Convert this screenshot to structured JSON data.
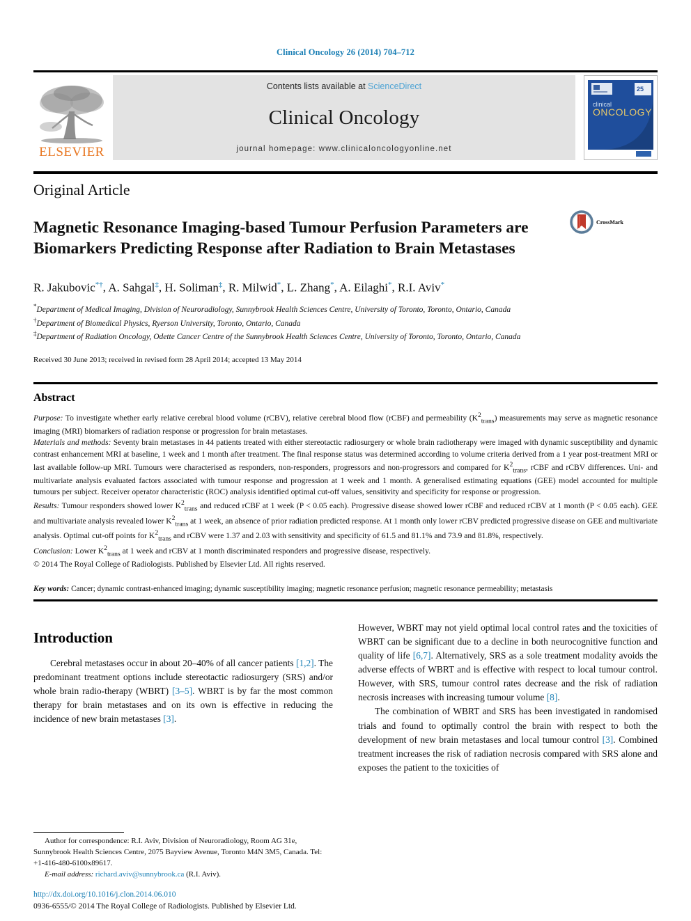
{
  "running_head": "Clinical Oncology 26 (2014) 704–712",
  "masthead": {
    "contents_prefix": "Contents lists available at ",
    "sciencedirect": "ScienceDirect",
    "journal_title": "Clinical Oncology",
    "homepage": "journal homepage: www.clinicaloncologyonline.net",
    "publisher_logo_text": "ELSEVIER",
    "cover_line1": "clinical",
    "cover_line2": "ONCOLOGY",
    "cover_badge": "25"
  },
  "article": {
    "type": "Original Article",
    "title": "Magnetic Resonance Imaging-based Tumour Perfusion Parameters are Biomarkers Predicting Response after Radiation to Brain Metastases",
    "crossmark_label": "CrossMark",
    "authors_html": "R. Jakubovic<sup class=\"sup-mark\">*†</sup>, A. Sahgal<sup class=\"sup-mark\">‡</sup>, H. Soliman<sup class=\"sup-mark\">‡</sup>, R. Milwid<sup class=\"sup-mark\">*</sup>, L. Zhang<sup class=\"sup-mark\">*</sup>, A. Eilaghi<sup class=\"sup-mark\">*</sup>, R.I. Aviv<sup class=\"sup-mark\">*</sup>",
    "affiliations": [
      {
        "marker": "*",
        "text": "Department of Medical Imaging, Division of Neuroradiology, Sunnybrook Health Sciences Centre, University of Toronto, Toronto, Ontario, Canada"
      },
      {
        "marker": "†",
        "text": "Department of Biomedical Physics, Ryerson University, Toronto, Ontario, Canada"
      },
      {
        "marker": "‡",
        "text": "Department of Radiation Oncology, Odette Cancer Centre of the Sunnybrook Health Sciences Centre, University of Toronto, Toronto, Ontario, Canada"
      }
    ],
    "dates": "Received 30 June 2013; received in revised form 28 April 2014; accepted 13 May 2014"
  },
  "abstract": {
    "heading": "Abstract",
    "purpose_label": "Purpose:",
    "purpose_text": " To investigate whether early relative cerebral blood volume (rCBV), relative cerebral blood flow (rCBF) and permeability (K<sup>2</sup><sub>trans</sub>) measurements may serve as magnetic resonance imaging (MRI) biomarkers of radiation response or progression for brain metastases.",
    "methods_label": "Materials and methods:",
    "methods_text": " Seventy brain metastases in 44 patients treated with either stereotactic radiosurgery or whole brain radiotherapy were imaged with dynamic susceptibility and dynamic contrast enhancement MRI at baseline, 1 week and 1 month after treatment. The final response status was determined according to volume criteria derived from a 1 year post-treatment MRI or last available follow-up MRI. Tumours were characterised as responders, non-responders, progressors and non-progressors and compared for K<sup>2</sup><sub>trans</sub>, rCBF and rCBV differences. Uni- and multivariate analysis evaluated factors associated with tumour response and progression at 1 week and 1 month. A generalised estimating equations (GEE) model accounted for multiple tumours per subject. Receiver operator characteristic (ROC) analysis identified optimal cut-off values, sensitivity and specificity for response or progression.",
    "results_label": "Results:",
    "results_text": " Tumour responders showed lower K<sup>2</sup><sub>trans</sub> and reduced rCBF at 1 week (P < 0.05 each). Progressive disease showed lower rCBF and reduced rCBV at 1 month (P < 0.05 each). GEE and multivariate analysis revealed lower K<sup>2</sup><sub>trans</sub> at 1 week, an absence of prior radiation predicted response. At 1 month only lower rCBV predicted progressive disease on GEE and multivariate analysis. Optimal cut-off points for K<sup>2</sup><sub>trans</sub> and rCBV were 1.37 and 2.03 with sensitivity and specificity of 61.5 and 81.1% and 73.9 and 81.8%, respectively.",
    "conclusion_label": "Conclusion:",
    "conclusion_text": " Lower K<sup>2</sup><sub>trans</sub> at 1 week and rCBV at 1 month discriminated responders and progressive disease, respectively.",
    "copyright": "© 2014 The Royal College of Radiologists. Published by Elsevier Ltd. All rights reserved.",
    "keywords_label": "Key words:",
    "keywords_text": " Cancer; dynamic contrast-enhanced imaging; dynamic susceptibility imaging; magnetic resonance perfusion; magnetic resonance permeability; metastasis"
  },
  "body": {
    "intro_heading": "Introduction",
    "col1_para1_html": "Cerebral metastases occur in about 20–40% of all cancer patients <span class=\"ref\">[1,2]</span>. The predominant treatment options include stereotactic radiosurgery (SRS) and/or whole brain radio-therapy (WBRT) <span class=\"ref\">[3–5]</span>. WBRT is by far the most common therapy for brain metastases and on its own is effective in reducing the incidence of new brain metastases <span class=\"ref\">[3]</span>.",
    "col2_para1_html": "However, WBRT may not yield optimal local control rates and the toxicities of WBRT can be significant due to a decline in both neurocognitive function and quality of life <span class=\"ref\">[6,7]</span>. Alternatively, SRS as a sole treatment modality avoids the adverse effects of WBRT and is effective with respect to local tumour control. However, with SRS, tumour control rates decrease and the risk of radiation necrosis increases with increasing tumour volume <span class=\"ref\">[8]</span>.",
    "col2_para2_html": "The combination of WBRT and SRS has been investigated in randomised trials and found to optimally control the brain with respect to both the development of new brain metastases and local tumour control <span class=\"ref\">[3]</span>. Combined treatment increases the risk of radiation necrosis compared with SRS alone and exposes the patient to the toxicities of"
  },
  "footnote": {
    "correspondence_html": "Author for correspondence: R.I. Aviv, Division of Neuroradiology, Room AG 31e, Sunnybrook Health Sciences Centre, 2075 Bayview Avenue, Toronto M4N 3M5, Canada. Tel: +1-416-480-6100x89617.",
    "email_label": "E-mail address:",
    "email": "richard.aviv@sunnybrook.ca",
    "email_owner": "(R.I. Aviv)."
  },
  "page_footer": {
    "doi": "http://dx.doi.org/10.1016/j.clon.2014.06.010",
    "issn_line": "0936-6555/© 2014 The Royal College of Radiologists. Published by Elsevier Ltd."
  },
  "colors": {
    "link_blue": "#1a7fb5",
    "sciencedirect_blue": "#4ea3d4",
    "elsevier_orange": "#E87722",
    "masthead_grey": "#e3e3e3",
    "cover_blue": "#1f4e9c"
  }
}
